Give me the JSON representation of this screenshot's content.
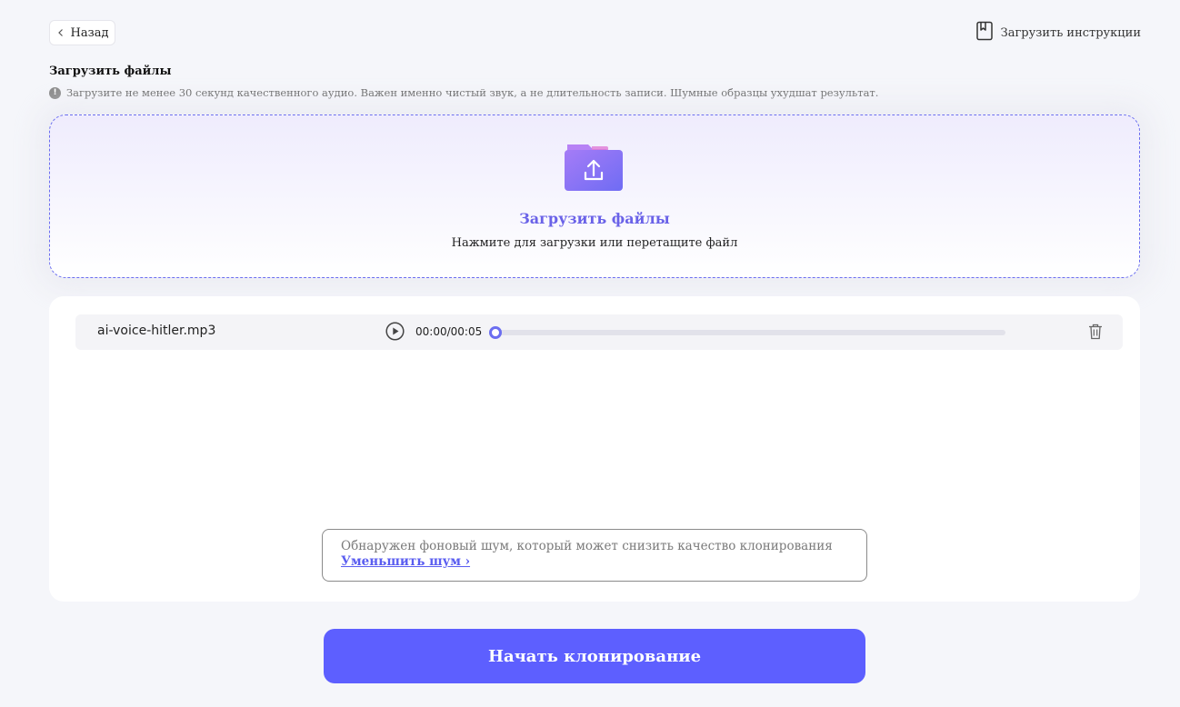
{
  "header": {
    "back_label": "Назад",
    "guide_label": "Загрузить инструкции"
  },
  "upload": {
    "section_title": "Загрузить файлы",
    "hint": "Загрузите не менее 30 секунд качественного аудио. Важен именно чистый звук, а не длительность записи. Шумные образцы ухудшат результат.",
    "dropzone_title": "Загрузить файлы",
    "dropzone_subtitle": "Нажмите для загрузки или перетащите файл"
  },
  "files": [
    {
      "name": "ai-voice-hitler.mp3",
      "time": "00:00/00:05",
      "progress": 0
    }
  ],
  "noise_notice": {
    "text": "Обнаружен фоновый шум, который может снизить качество клонирования ",
    "link": "Уменьшить шум ›"
  },
  "start_button": "Начать клонирование",
  "colors": {
    "accent": "#5d5fff",
    "accent_text": "#6a62e8",
    "background": "#f5f6fa"
  }
}
